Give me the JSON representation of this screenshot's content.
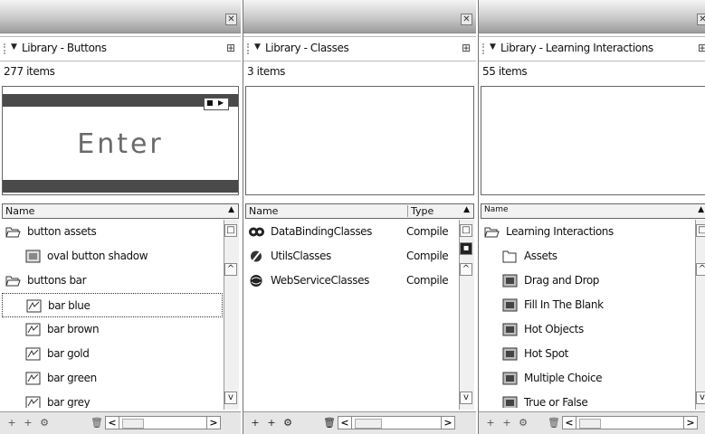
{
  "panels": [
    {
      "title": "Library - Buttons",
      "count": "277 items",
      "preview_text": "Enter",
      "columns": [
        "Name"
      ],
      "items": [
        {
          "label": "button assets",
          "icon": "folder-open-icon",
          "indent": 0
        },
        {
          "label": "oval button shadow",
          "icon": "graphic-symbol-icon",
          "indent": 1
        },
        {
          "label": "buttons bar",
          "icon": "folder-open-icon",
          "indent": 0
        },
        {
          "label": "bar blue",
          "icon": "button-symbol-icon",
          "indent": 1,
          "selected": true
        },
        {
          "label": "bar brown",
          "icon": "button-symbol-icon",
          "indent": 1
        },
        {
          "label": "bar gold",
          "icon": "button-symbol-icon",
          "indent": 1
        },
        {
          "label": "bar green",
          "icon": "button-symbol-icon",
          "indent": 1
        },
        {
          "label": "bar grey",
          "icon": "button-symbol-icon",
          "indent": 1
        }
      ]
    },
    {
      "title": "Library - Classes",
      "count": "3 items",
      "columns": [
        "Name",
        "Type"
      ],
      "items": [
        {
          "label": "DataBindingClasses",
          "type": "Compile",
          "icon": "compiled-clip-icon"
        },
        {
          "label": "UtilsClasses",
          "type": "Compile",
          "icon": "compiled-clip-icon"
        },
        {
          "label": "WebServiceClasses",
          "type": "Compile",
          "icon": "compiled-clip-icon"
        }
      ]
    },
    {
      "title": "Library - Learning Interactions",
      "count": "55 items",
      "columns": [
        "Name"
      ],
      "items": [
        {
          "label": "Learning Interactions",
          "icon": "folder-open-icon",
          "indent": 0
        },
        {
          "label": "Assets",
          "icon": "folder-closed-icon",
          "indent": 1
        },
        {
          "label": "Drag and Drop",
          "icon": "movieclip-symbol-icon",
          "indent": 1
        },
        {
          "label": "Fill In The Blank",
          "icon": "movieclip-symbol-icon",
          "indent": 1
        },
        {
          "label": "Hot Objects",
          "icon": "movieclip-symbol-icon",
          "indent": 1
        },
        {
          "label": "Hot Spot",
          "icon": "movieclip-symbol-icon",
          "indent": 1
        },
        {
          "label": "Multiple Choice",
          "icon": "movieclip-symbol-icon",
          "indent": 1
        },
        {
          "label": "True or False",
          "icon": "movieclip-symbol-icon",
          "indent": 1
        }
      ]
    }
  ],
  "colors": {
    "titlebar": "#c9c9c9",
    "preview_bar": "#4a4a4a",
    "footer": "#e6e6e6"
  }
}
